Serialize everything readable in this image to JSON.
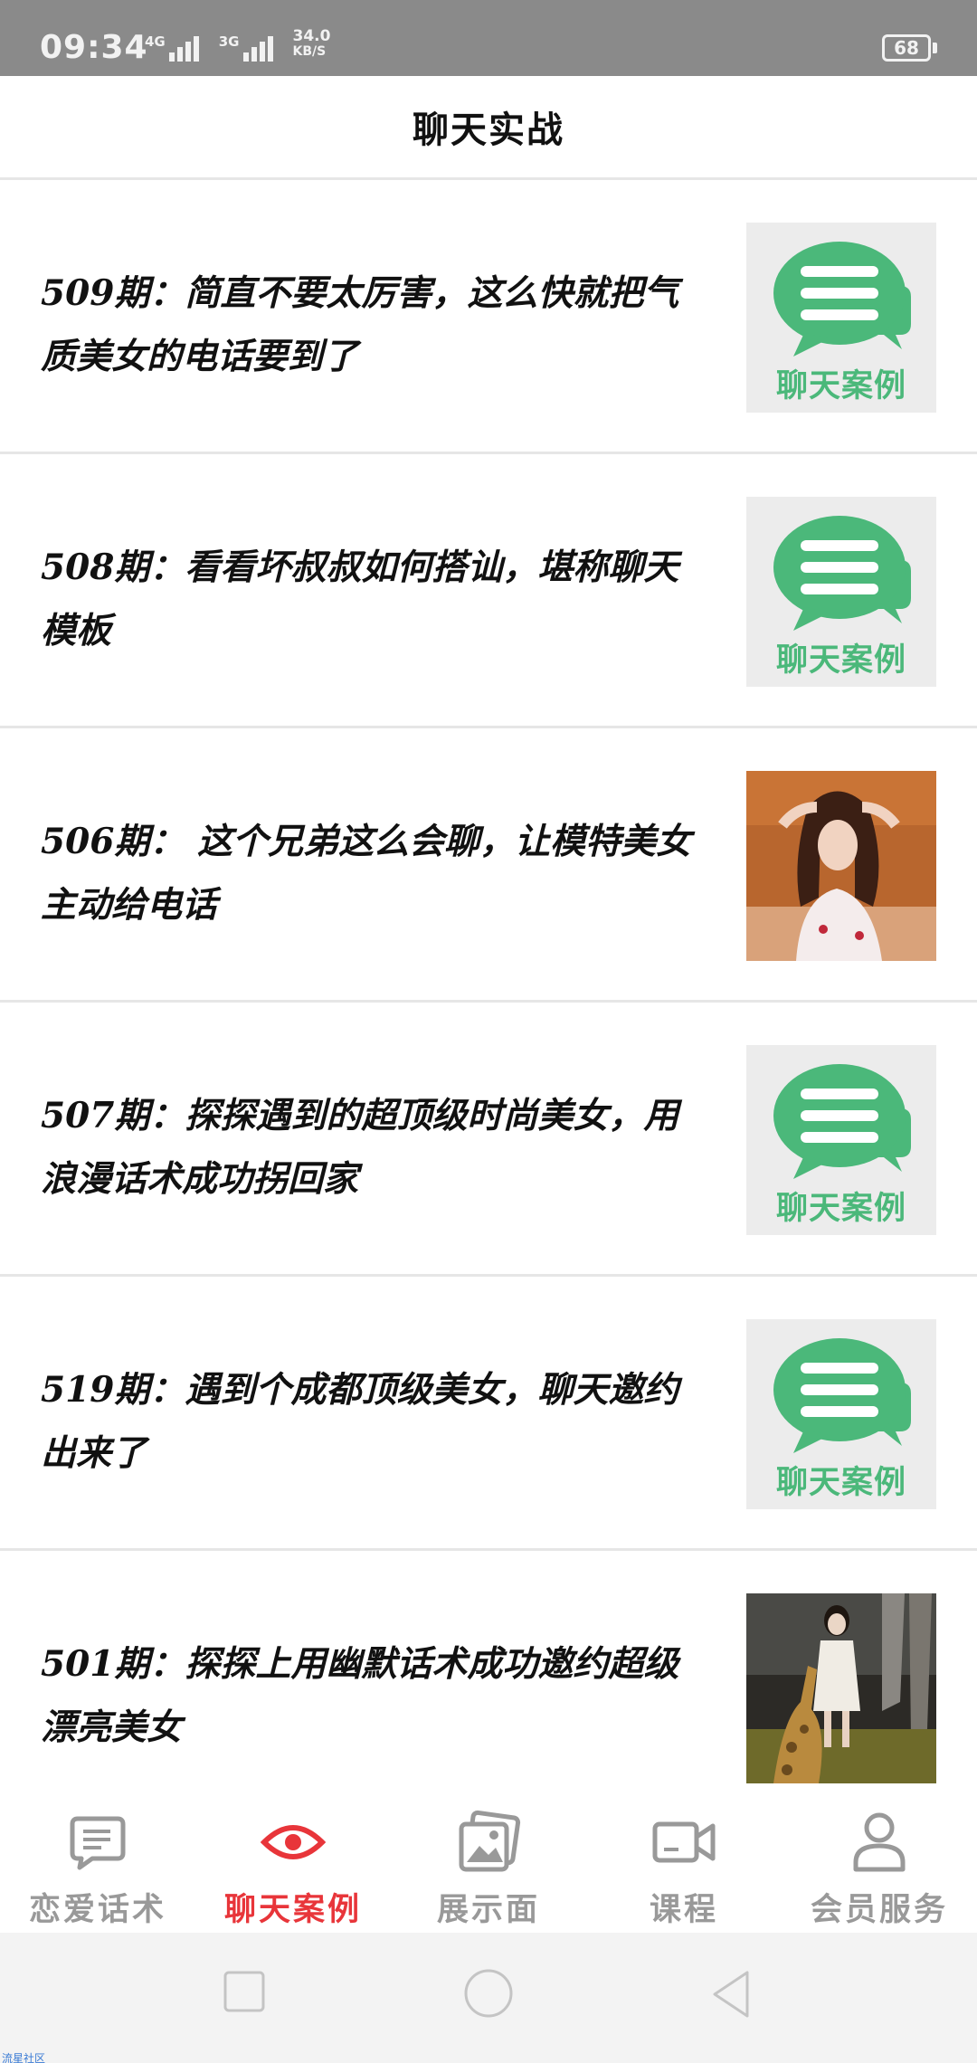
{
  "status_bar": {
    "time": "09:34",
    "network_1": "4G",
    "network_2": "3G",
    "speed_value": "34.0",
    "speed_unit": "KB/S",
    "battery": "68"
  },
  "header": {
    "title": "聊天实战"
  },
  "thumb_caption": "聊天案例",
  "colors": {
    "accent": "#e8353a",
    "chat_green": "#4bb87a",
    "tab_inactive": "#999999"
  },
  "items": [
    {
      "title": "509期：简直不要太厉害，这么快就把气质美女的电话要到了",
      "thumb": "chat-icon"
    },
    {
      "title": "508期：看看坏叔叔如何搭讪，堪称聊天模板",
      "thumb": "chat-icon"
    },
    {
      "title": "506期：  这个兄弟这么会聊，让模特美女主动给电话",
      "thumb": "photo"
    },
    {
      "title": "507期：探探遇到的超顶级时尚美女，用浪漫话术成功拐回家",
      "thumb": "chat-icon"
    },
    {
      "title": "519期：遇到个成都顶级美女，聊天邀约出来了",
      "thumb": "chat-icon"
    },
    {
      "title": "501期：探探上用幽默话术成功邀约超级漂亮美女",
      "thumb": "photo"
    }
  ],
  "tabs": [
    {
      "label": "恋爱话术",
      "icon": "chat-lines-icon",
      "active": false
    },
    {
      "label": "聊天案例",
      "icon": "eye-icon",
      "active": true
    },
    {
      "label": "展示面",
      "icon": "pictures-icon",
      "active": false
    },
    {
      "label": "课程",
      "icon": "video-icon",
      "active": false
    },
    {
      "label": "会员服务",
      "icon": "person-icon",
      "active": false
    }
  ],
  "watermark": "流星社区"
}
